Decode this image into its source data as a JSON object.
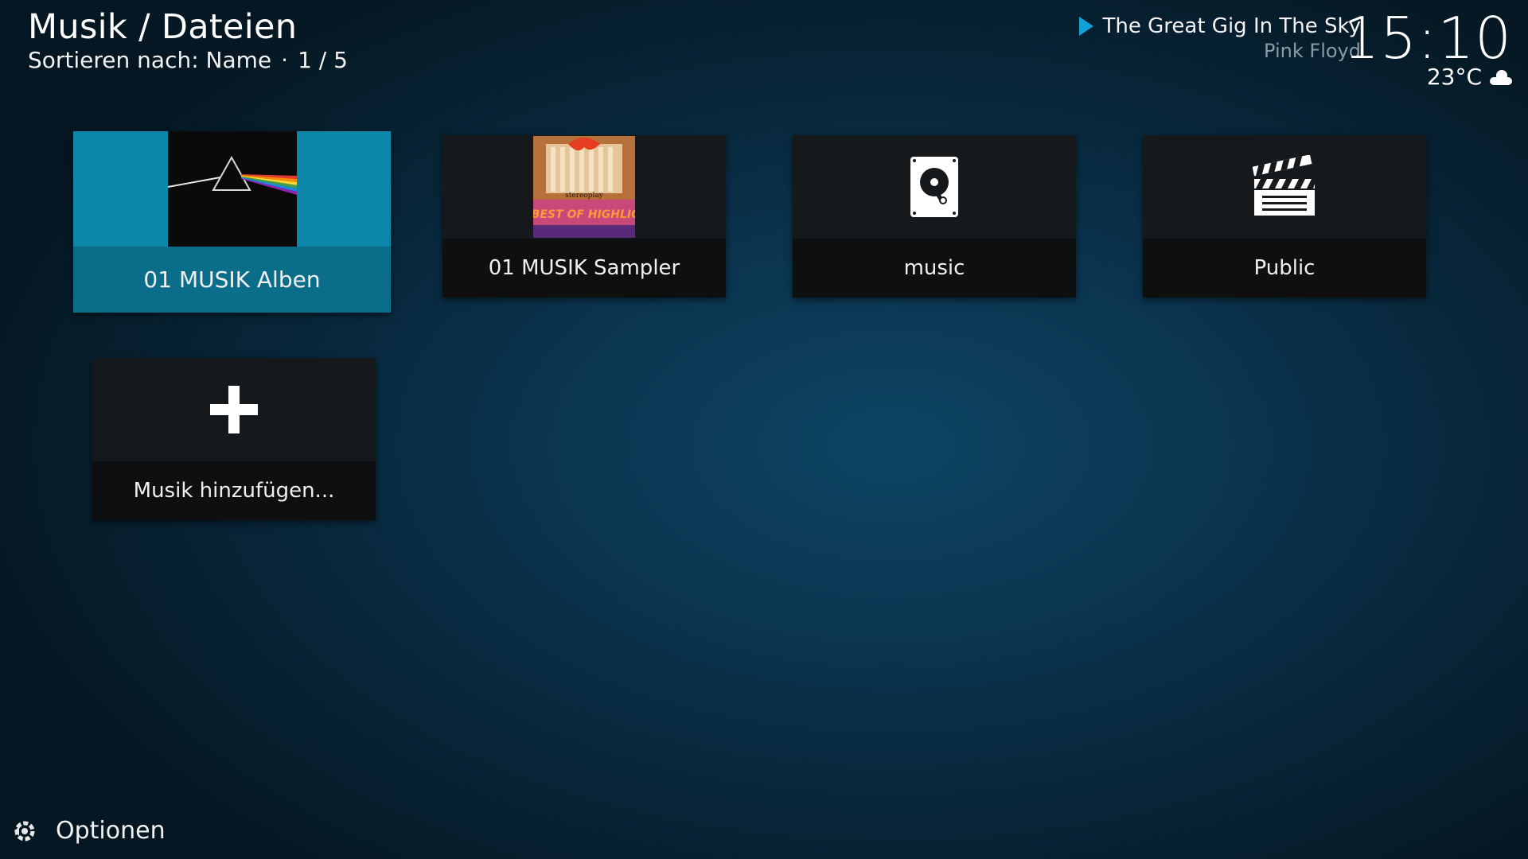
{
  "header": {
    "title": "Musik / Dateien",
    "sort_label": "Sortieren nach: Name",
    "position": "1 / 5"
  },
  "now_playing": {
    "title": "The Great Gig In The Sky",
    "artist": "Pink Floyd",
    "icon": "play-icon"
  },
  "clock": {
    "time": "15:10",
    "temperature": "23°C",
    "weather_icon": "cloud-icon"
  },
  "tiles": [
    {
      "label": "01 MUSIK Alben",
      "thumb": "album-art-dark-side",
      "focused": true
    },
    {
      "label": "01 MUSIK Sampler",
      "thumb": "album-art-best-of-highlights",
      "thumb_text": "THE BEST OF HIGHLIGHTS",
      "thumb_brand": "stereoplay"
    },
    {
      "label": "music",
      "thumb": "harddisk-icon"
    },
    {
      "label": "Public",
      "thumb": "clapperboard-icon"
    },
    {
      "label": "Musik hinzufügen...",
      "thumb": "plus-icon"
    }
  ],
  "footer": {
    "options_label": "Optionen",
    "icon": "options-gear-icon"
  },
  "colors": {
    "accent": "#12a0d7",
    "focus_bg": "#0d87aa",
    "focus_label_bg": "#0a6d8a"
  }
}
